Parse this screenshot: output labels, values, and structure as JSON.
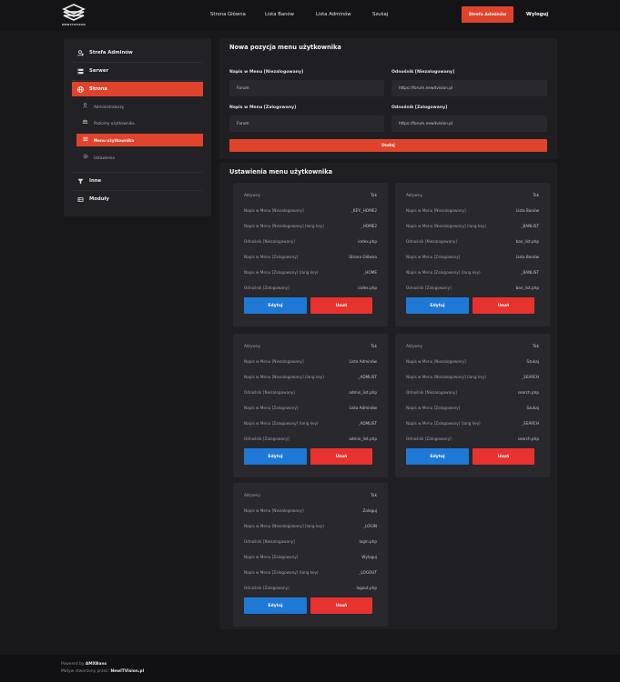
{
  "brand": {
    "logo_text": "NEWITVISION"
  },
  "nav": {
    "links": [
      "Strona Główna",
      "Lista Banów",
      "Lista Adminów",
      "Szukaj"
    ],
    "admin_button": "Strefa Adminów",
    "logout": "Wyloguj"
  },
  "sidebar": {
    "items": [
      {
        "label": "Strefa Adminów",
        "icon": "user-shield-icon"
      },
      {
        "label": "Serwer",
        "icon": "server-icon"
      },
      {
        "label": "Strona",
        "icon": "globe-icon"
      },
      {
        "label": "Inne",
        "icon": "filter-icon"
      },
      {
        "label": "Moduły",
        "icon": "modules-icon"
      }
    ],
    "subitems": [
      {
        "label": "Administratorzy",
        "icon": "user-shield-icon"
      },
      {
        "label": "Poziomy użytkownika",
        "icon": "users-icon"
      },
      {
        "label": "Menu użytkownika",
        "icon": "menu-icon"
      },
      {
        "label": "Ustawienia",
        "icon": "gear-icon"
      }
    ]
  },
  "new_item": {
    "title": "Nowa pozycja menu użytkownika",
    "label_unlogged": "Napis w Menu [Niezalogowany]",
    "value_unlogged": "Forum",
    "link_unlogged_label": "Odnośnik [Niezalogowany]",
    "link_unlogged": "https://forum.newitvision.pl",
    "label_logged": "Napis w Menu [Zalogowany]",
    "value_logged": "Forum",
    "link_logged_label": "Odnośnik [Zalogowany]",
    "link_logged": "https://forum.newitvision.pl",
    "add_button": "Dodaj"
  },
  "settings": {
    "title": "Ustawienia menu użytkownika",
    "edit_label": "Edytuj",
    "delete_label": "Usuń",
    "row_labels": [
      "Aktywny",
      "Napis w Menu [Niezalogowany]",
      "Napis w Menu [Niezalogowany] (lang key)",
      "Odnośnik [Niezalogowany]",
      "Napis w Menu [Zalogowany]",
      "Napis w Menu [Zalogowany] (lang key)",
      "Odnośnik [Zalogowany]"
    ],
    "cards": [
      {
        "values": [
          "Tak",
          "_KEY:_HOME2",
          "_HOME2",
          "index.php",
          "Strona Główna",
          "_HOME",
          "index.php"
        ]
      },
      {
        "values": [
          "Tak",
          "Lista Banów",
          "_BANLIST",
          "ban_list.php",
          "Lista Banów",
          "_BANLIST",
          "ban_list.php"
        ]
      },
      {
        "values": [
          "Tak",
          "Lista Adminów",
          "_ADMLIST",
          "admin_list.php",
          "Lista Adminów",
          "_ADMLIST",
          "admin_list.php"
        ]
      },
      {
        "values": [
          "Tak",
          "Szukaj",
          "_SEARCH",
          "search.php",
          "Szukaj",
          "_SEARCH",
          "search.php"
        ]
      },
      {
        "values": [
          "Tak",
          "Zaloguj",
          "_LOGIN",
          "login.php",
          "Wyloguj",
          "_LOGOUT",
          "logout.php"
        ]
      }
    ]
  },
  "footer": {
    "powered_prefix": "Powered by",
    "powered_name": "AMXBans",
    "theme_prefix": "Motyw stworzony przez:",
    "theme_name": "NewITVision.pl"
  },
  "colors": {
    "accent": "#e0432b",
    "edit_blue": "#1e79d6",
    "delete_red": "#e8322f",
    "background": "#18181b",
    "panel": "#1f1f23"
  }
}
